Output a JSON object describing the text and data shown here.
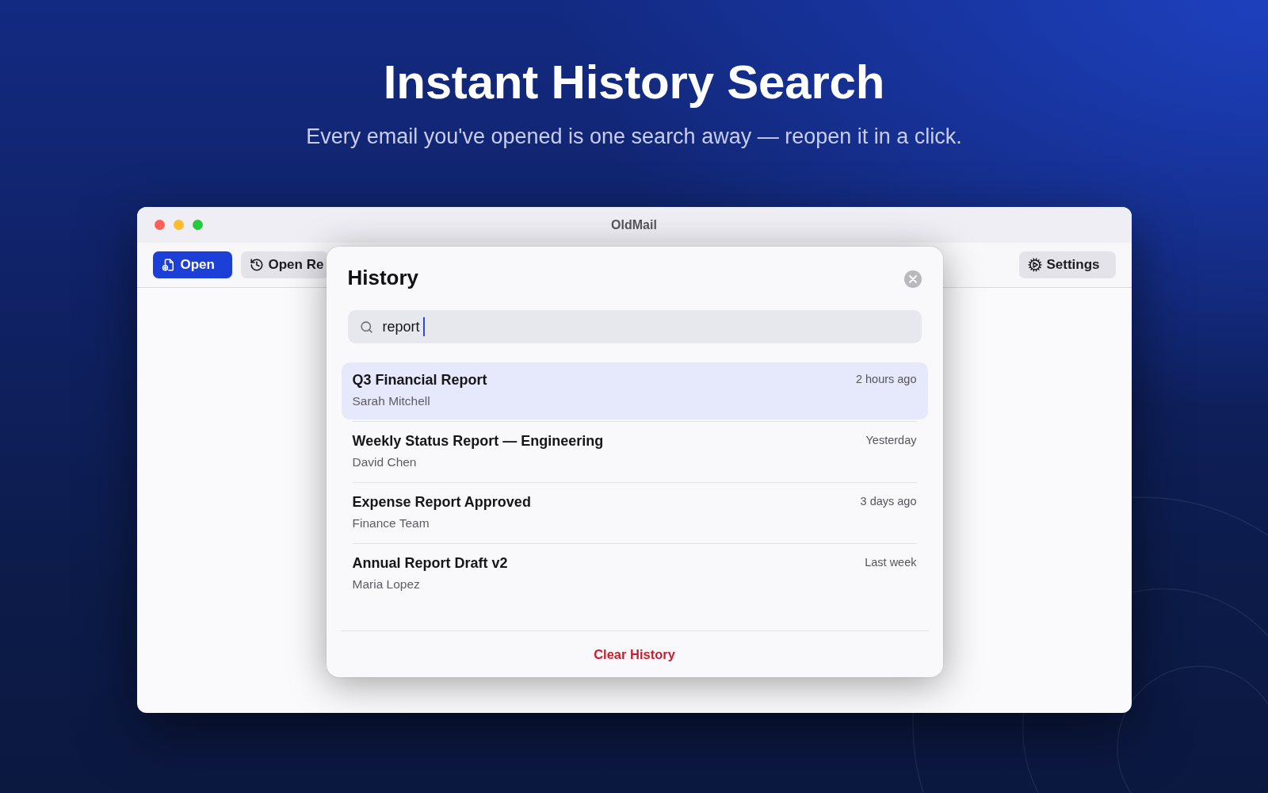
{
  "hero": {
    "title": "Instant History Search",
    "subtitle": "Every email you've opened is one search away — reopen it in a click."
  },
  "window": {
    "title": "OldMail"
  },
  "toolbar": {
    "open_button": "Open",
    "recent_button": "Open Re",
    "settings_button": "Settings"
  },
  "history_dialog": {
    "title": "History",
    "search": {
      "value": "report",
      "focused": true
    },
    "results": [
      {
        "title": "Q3 Financial Report",
        "sender": "Sarah Mitchell",
        "time": "2 hours ago",
        "selected": true
      },
      {
        "title": "Weekly Status Report — Engineering",
        "sender": "David Chen",
        "time": "Yesterday",
        "selected": false
      },
      {
        "title": "Expense Report Approved",
        "sender": "Finance Team",
        "time": "3 days ago",
        "selected": false
      },
      {
        "title": "Annual Report Draft v2",
        "sender": "Maria Lopez",
        "time": "Last week",
        "selected": false
      }
    ],
    "clear_button": "Clear History"
  }
}
